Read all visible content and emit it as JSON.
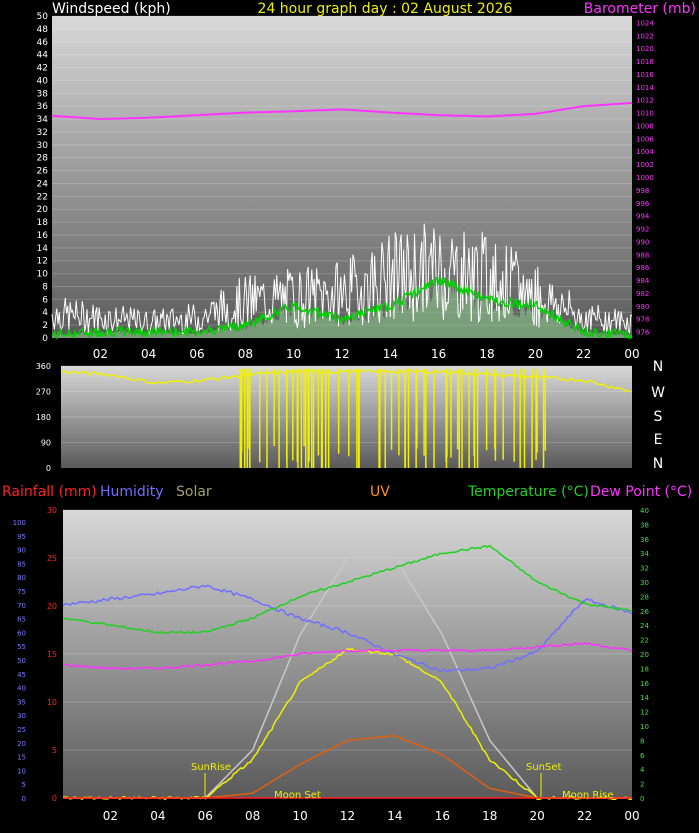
{
  "title": "24 hour graph day : 02 August 2026",
  "colors": {
    "background": "#000000",
    "wind": "#ffffff",
    "gust": "#ffffff",
    "wind_avg": "#00d000",
    "wind_fill": "#90d090",
    "barometer": "#ff33ff",
    "direction": "#f0f000",
    "rainfall": "#ff2020",
    "humidity": "#7070ff",
    "solar": "#a0a070",
    "uv": "#ff9020",
    "temperature": "#20d020",
    "dewpoint": "#ff33ff",
    "solar_max": "#c8c8c8",
    "solar_actual": "#f0f000",
    "uv_curve": "#e06010",
    "axis_text": "#ffffff",
    "left_axis_small": "#7a7aff",
    "right_axis_small": "#40e040"
  },
  "x_axis": {
    "ticks": [
      "02",
      "04",
      "06",
      "08",
      "10",
      "12",
      "14",
      "16",
      "18",
      "20",
      "22",
      "00"
    ]
  },
  "chart_data": [
    {
      "type": "line",
      "name": "wind-barometer",
      "left_title": "Windspeed (kph)",
      "right_title": "Barometer (mb)",
      "ylim_left": [
        0,
        50
      ],
      "ylim_right": [
        975,
        1025
      ],
      "left_ticks": [
        "0",
        "2",
        "4",
        "6",
        "8",
        "10",
        "12",
        "14",
        "16",
        "18",
        "20",
        "22",
        "24",
        "26",
        "28",
        "30",
        "32",
        "34",
        "36",
        "38",
        "40",
        "42",
        "44",
        "46",
        "48",
        "50"
      ],
      "right_ticks": [
        "976",
        "978",
        "980",
        "982",
        "984",
        "986",
        "988",
        "990",
        "992",
        "994",
        "996",
        "998",
        "1000",
        "1002",
        "1004",
        "1006",
        "1008",
        "1010",
        "1012",
        "1014",
        "1016",
        "1018",
        "1020",
        "1022",
        "1024"
      ],
      "x_hours": [
        0,
        2,
        4,
        6,
        8,
        10,
        12,
        14,
        16,
        18,
        20,
        22,
        24
      ],
      "series": [
        {
          "key": "barometer",
          "values": [
            1009.5,
            1009,
            1009.2,
            1009.6,
            1010,
            1010.2,
            1010.5,
            1010,
            1009.6,
            1009.4,
            1009.8,
            1011,
            1011.5
          ]
        },
        {
          "key": "gust",
          "values": [
            6,
            5,
            4,
            5,
            9,
            10,
            11,
            15,
            17,
            15,
            11,
            5,
            4
          ]
        },
        {
          "key": "wind_avg",
          "values": [
            0.5,
            1,
            1,
            1,
            2,
            5,
            3,
            5,
            9,
            6,
            5,
            1,
            0.5
          ]
        }
      ]
    },
    {
      "type": "line",
      "name": "wind-direction",
      "ylim": [
        0,
        360
      ],
      "y_ticks": [
        "0",
        "90",
        "180",
        "270",
        "360"
      ],
      "compass_labels": [
        "N",
        "W",
        "S",
        "E",
        "N"
      ],
      "x_hours": [
        0,
        2,
        4,
        6,
        8,
        10,
        12,
        14,
        16,
        18,
        20,
        22,
        24
      ],
      "series": [
        {
          "key": "direction",
          "values": [
            340,
            330,
            300,
            310,
            330,
            340,
            340,
            340,
            340,
            330,
            320,
            310,
            270
          ]
        }
      ]
    },
    {
      "type": "line",
      "name": "weather-composite",
      "legend": [
        "Rainfall (mm)",
        "Humidity",
        "Solar",
        "UV",
        "Temperature (°C)",
        "Dew Point (°C)"
      ],
      "annotations": [
        "SunRise",
        "SunSet",
        "Moon Set",
        "Moon Rise"
      ],
      "rain_ticks": [
        "0",
        "5",
        "10",
        "15",
        "20",
        "25",
        "30"
      ],
      "humidity_ticks": [
        "0",
        "5",
        "10",
        "15",
        "20",
        "25",
        "30",
        "35",
        "40",
        "45",
        "50",
        "55",
        "60",
        "65",
        "70",
        "75",
        "80",
        "85",
        "90",
        "95",
        "100"
      ],
      "temp_ticks": [
        "0",
        "2",
        "4",
        "6",
        "8",
        "10",
        "12",
        "14",
        "16",
        "18",
        "20",
        "22",
        "24",
        "26",
        "28",
        "30",
        "32",
        "34",
        "36",
        "38",
        "40"
      ],
      "ylim_humidity": [
        0,
        100
      ],
      "ylim_temperature": [
        0,
        40
      ],
      "ylim_rain": [
        0,
        30
      ],
      "x_hours": [
        0,
        2,
        4,
        6,
        8,
        10,
        12,
        14,
        16,
        18,
        20,
        22,
        24
      ],
      "series": [
        {
          "key": "humidity",
          "values": [
            70,
            72,
            74,
            77,
            72,
            65,
            60,
            52,
            46,
            47,
            53,
            72,
            67
          ]
        },
        {
          "key": "temperature",
          "values": [
            25,
            24,
            23,
            23,
            25,
            28,
            30,
            32,
            34,
            35,
            30,
            27,
            26
          ]
        },
        {
          "key": "dewpoint",
          "values": [
            18.5,
            18,
            18,
            18.5,
            19,
            20,
            20.5,
            20.5,
            20.5,
            20.5,
            21,
            21.5,
            20.5
          ]
        },
        {
          "key": "solar_max",
          "values": [
            0,
            0,
            0,
            0,
            5,
            17,
            25,
            25,
            17,
            6,
            0,
            0,
            0
          ]
        },
        {
          "key": "solar_actual",
          "values": [
            0,
            0,
            0,
            0,
            4,
            12,
            15.5,
            15,
            12,
            4,
            0,
            0,
            0
          ]
        },
        {
          "key": "uv_curve",
          "values": [
            0,
            0,
            0,
            0,
            0.5,
            3.5,
            6,
            6.5,
            4.5,
            1,
            0,
            0,
            0
          ]
        },
        {
          "key": "rainfall",
          "values": [
            0,
            0,
            0,
            0,
            0,
            0,
            0,
            0,
            0,
            0,
            0,
            0,
            0
          ]
        }
      ]
    }
  ]
}
